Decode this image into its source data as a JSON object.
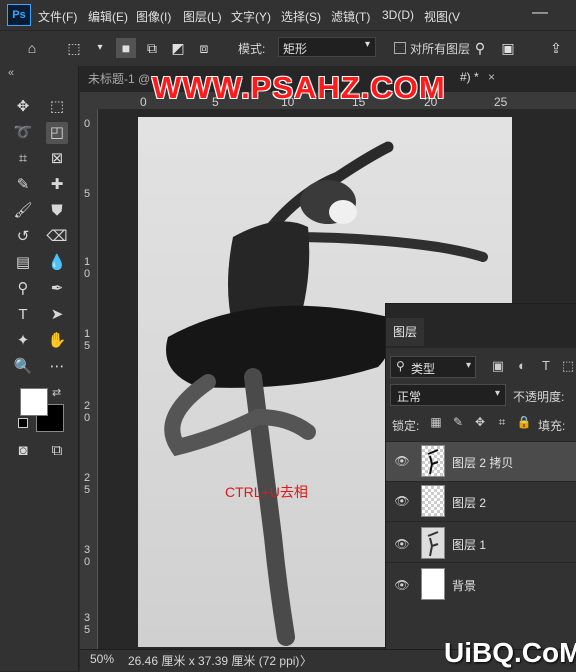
{
  "menubar": {
    "logo": "Ps",
    "items": [
      "文件(F)",
      "编辑(E)",
      "图像(I)",
      "图层(L)",
      "文字(Y)",
      "选择(S)",
      "滤镜(T)",
      "3D(D)",
      "视图(V"
    ],
    "minimize": "—"
  },
  "options": {
    "mode_label": "模式:",
    "mode_value": "矩形",
    "all_layers_label": "对所有图层"
  },
  "tabs": [
    {
      "label": "未标题-1 @"
    },
    {
      "label": "#) *"
    }
  ],
  "tab_close": "×",
  "ruler": {
    "h": [
      "0",
      "5",
      "10",
      "15",
      "20",
      "25"
    ],
    "v": [
      "0",
      "5",
      "1\n0",
      "1\n5",
      "2\n0",
      "2\n5",
      "3\n0",
      "3\n5"
    ]
  },
  "canvas": {
    "annotation": "CTRL+U去相"
  },
  "watermarks": {
    "top": "WWW.PSAHZ.COM",
    "bottom": "UiBQ.CoM"
  },
  "status": {
    "zoom": "50%",
    "doc_info": "26.46 厘米 x 37.39 厘米 (72 ppi)",
    "arrow": "〉"
  },
  "layers_panel": {
    "tab_label": "图层",
    "filter_value": "类型",
    "blend_mode": "正常",
    "opacity_label": "不透明度:",
    "lock_label": "锁定:",
    "fill_label": "填充:",
    "layers": [
      {
        "name": "图层 2 拷贝",
        "selected": true
      },
      {
        "name": "图层 2",
        "selected": false
      },
      {
        "name": "图层 1",
        "selected": false
      },
      {
        "name": "背景",
        "selected": false
      }
    ]
  },
  "colors": {
    "foreground": "#ffffff",
    "background": "#000000",
    "accent": "#31a8ff",
    "annotation": "#e01818"
  }
}
